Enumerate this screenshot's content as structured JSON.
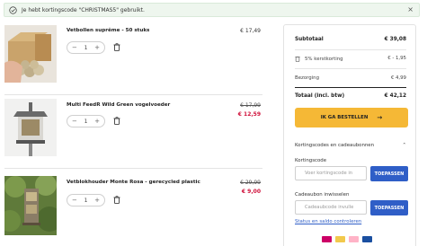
{
  "notice": {
    "text": "Je hebt kortingscode \"CHRISTMAS5\" gebruikt."
  },
  "items": [
    {
      "name": "Vetbollen suprême - 50 stuks",
      "quantity": "1",
      "price": "€ 17,49"
    },
    {
      "name": "Multi FeedR Wild Green vogelvoeder",
      "quantity": "1",
      "old_price": "€ 17,99",
      "new_price": "€ 12,59"
    },
    {
      "name": "Vetblokhouder Monte Rosa - gerecycled plastic",
      "quantity": "1",
      "old_price": "€ 29,99",
      "new_price": "€ 9,00"
    }
  ],
  "summary": {
    "subtotal_label": "Subtotaal",
    "subtotal_value": "€ 39,08",
    "discount_label": "5% kerstkorting",
    "discount_value": "€ - 1,95",
    "shipping_label": "Bezorging",
    "shipping_value": "€ 4,99",
    "total_label": "Totaal (incl. btw)",
    "total_value": "€ 42,12",
    "checkout_label": "IK GA BESTELLEN",
    "codes_section_label": "Kortingscodes en cadeaubonnen",
    "coupon_label": "Kortingscode",
    "coupon_placeholder": "Voer kortingscode in",
    "coupon_button": "TOEPASSEN",
    "voucher_label": "Cadeaubon inwisselen",
    "voucher_placeholder": "Cadeaubcode invulle",
    "voucher_button": "TOEPASSEN",
    "status_link": "Status en saldo controleren"
  },
  "colors": {
    "accent_yellow": "#f5b836",
    "accent_blue": "#2f5ec7",
    "sale_red": "#d0103a"
  }
}
